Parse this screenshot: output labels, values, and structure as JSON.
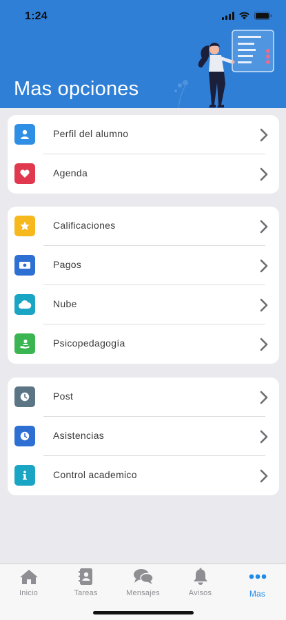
{
  "status_bar": {
    "time": "1:24"
  },
  "header": {
    "title": "Mas opciones"
  },
  "sections": [
    {
      "items": [
        {
          "label": "Perfil del alumno",
          "icon": "user-icon",
          "color": "#2f8fe5"
        },
        {
          "label": "Agenda",
          "icon": "heart-icon",
          "color": "#e0394f"
        }
      ]
    },
    {
      "items": [
        {
          "label": "Calificaciones",
          "icon": "star-icon",
          "color": "#f6b81c"
        },
        {
          "label": "Pagos",
          "icon": "money-icon",
          "color": "#2d6fd3"
        },
        {
          "label": "Nube",
          "icon": "cloud-icon",
          "color": "#1aa5c4"
        },
        {
          "label": "Psicopedagogía",
          "icon": "hand-user-icon",
          "color": "#3bb552"
        }
      ]
    },
    {
      "items": [
        {
          "label": "Post",
          "icon": "clock-icon",
          "color": "#5b7585"
        },
        {
          "label": "Asistencias",
          "icon": "clock-icon",
          "color": "#2d6fd3"
        },
        {
          "label": "Control academico",
          "icon": "info-icon",
          "color": "#1aa5c4"
        }
      ]
    }
  ],
  "tab_bar": {
    "tabs": [
      {
        "label": "Inicio",
        "icon": "home-icon",
        "active": false
      },
      {
        "label": "Tareas",
        "icon": "contacts-book-icon",
        "active": false
      },
      {
        "label": "Mensajes",
        "icon": "chat-bubbles-icon",
        "active": false
      },
      {
        "label": "Avisos",
        "icon": "bell-icon",
        "active": false
      },
      {
        "label": "Mas",
        "icon": "more-dots-icon",
        "active": true
      }
    ],
    "active_color": "#1f8be8",
    "inactive_color": "#8e8e93"
  },
  "colors": {
    "header": "#2f7fd6",
    "background": "#e9e9ee"
  }
}
